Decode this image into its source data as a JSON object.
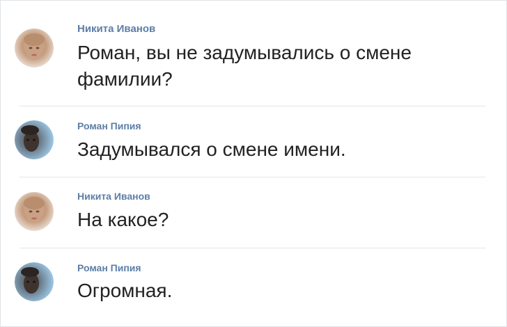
{
  "messages": [
    {
      "author": "Никита Иванов",
      "text": "Роман, вы не задумывались о смене фамилии?",
      "avatar_icon": "avatar-nikita-icon"
    },
    {
      "author": "Роман Пипия",
      "text": "Задумывался о смене имени.",
      "avatar_icon": "avatar-roman-icon"
    },
    {
      "author": "Никита Иванов",
      "text": "На какое?",
      "avatar_icon": "avatar-nikita-icon"
    },
    {
      "author": "Роман Пипия",
      "text": "Огромная.",
      "avatar_icon": "avatar-roman-icon"
    }
  ],
  "colors": {
    "author": "#5c7ea6",
    "text": "#222222",
    "divider": "#e1e5ea"
  }
}
